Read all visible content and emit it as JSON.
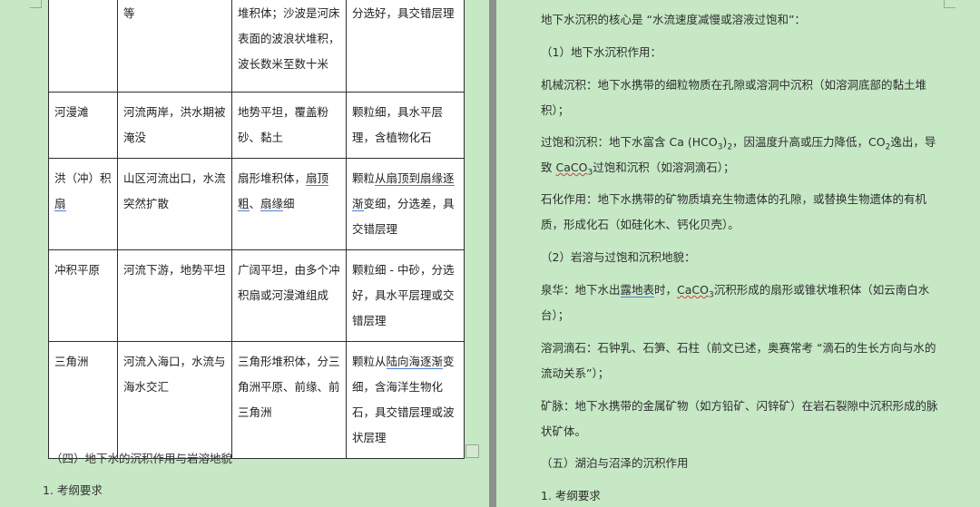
{
  "table": {
    "rows": [
      [
        "",
        "等",
        "堆积体；沙波是河床表面的波浪状堆积，波长数米至数十米",
        "分选好，具交错层理"
      ],
      [
        "河漫滩",
        "河流两岸，洪水期被淹没",
        "地势平坦，覆盖粉砂、黏土",
        "颗粒细，具水平层理，含植物化石"
      ],
      [
        "洪（冲）积扇",
        "山区河流出口，水流突然扩散",
        "扇形堆积体，扇顶粗、扇缘细",
        "颗粒从扇顶到扇缘逐渐变细，分选差，具交错层理"
      ],
      [
        "冲积平原",
        "河流下游，地势平坦",
        "广阔平坦，由多个冲积扇或河漫滩组成",
        "颗粒细 - 中砂，分选好，具水平层理或交错层理"
      ],
      [
        "三角洲",
        "河流入海口，水流与海水交汇",
        "三角形堆积体，分三角洲平原、前缘、前三角洲",
        "颗粒从陆向海逐渐变细，含海洋生物化石，具交错层理或波状层理"
      ]
    ],
    "r3c0_a": "洪（冲）积",
    "r3c0_b": "扇",
    "r3c2_a": "扇形堆积体，",
    "r3c2_b": "扇顶",
    "r3c2_c": "粗",
    "r3c2_d": "、",
    "r3c2_e": "扇缘",
    "r3c2_f": "细",
    "r3c3_a": "颗粒",
    "r3c3_b": "从扇顶到扇缘逐",
    "r3c3_c": "渐",
    "r3c3_d": "变细，分选差，具交错层理",
    "r5c3_a": "颗粒从",
    "r5c3_b": "陆向海逐渐",
    "r5c3_c": "变细，含海洋生物化石，具交错层理或波状层理"
  },
  "left_page": {
    "section_heading": "（四）地下水的沉积作用与岩溶地貌",
    "item_1": "1.  考纲要求"
  },
  "right_page": {
    "p1": "地下水沉积的核心是 “水流速度减慢或溶液过饱和”：",
    "p2": "（1）地下水沉积作用：",
    "p3": "机械沉积：地下水携带的细粒物质在孔隙或溶洞中沉积（如溶洞底部的黏土堆积）；",
    "p4_a": "过饱和沉积：地下水富含 Ca (HCO",
    "p4_sub1": "3",
    "p4_b": ")",
    "p4_sub2": "2",
    "p4_c": "，因温度升高或压力降低，CO",
    "p4_sub3": "2",
    "p4_d": "逸出，导致 ",
    "p4_e": "CaCO",
    "p4_sub4": "3",
    "p4_f": "过饱和沉积（如溶洞滴石）；",
    "p5": "石化作用：地下水携带的矿物质填充生物遗体的孔隙，或替换生物遗体的有机质，形成化石（如硅化木、钙化贝壳）。",
    "p6": "（2）岩溶与过饱和沉积地貌：",
    "p7_a": "泉华：地下水出",
    "p7_b": "露地表",
    "p7_c": "时，",
    "p7_d": "CaCO",
    "p7_sub": "3",
    "p7_e": "沉积形成的扇形或锥状堆积体（如云南白水台）；",
    "p8": "溶洞滴石：石钟乳、石笋、石柱（前文已述，奥赛常考 “滴石的生长方向与水的流动关系”）；",
    "p9": "矿脉：地下水携带的金属矿物（如方铅矿、闪锌矿）在岩石裂隙中沉积形成的脉状矿体。",
    "p10": "（五）湖泊与沼泽的沉积作用",
    "p11": "1.  考纲要求"
  }
}
